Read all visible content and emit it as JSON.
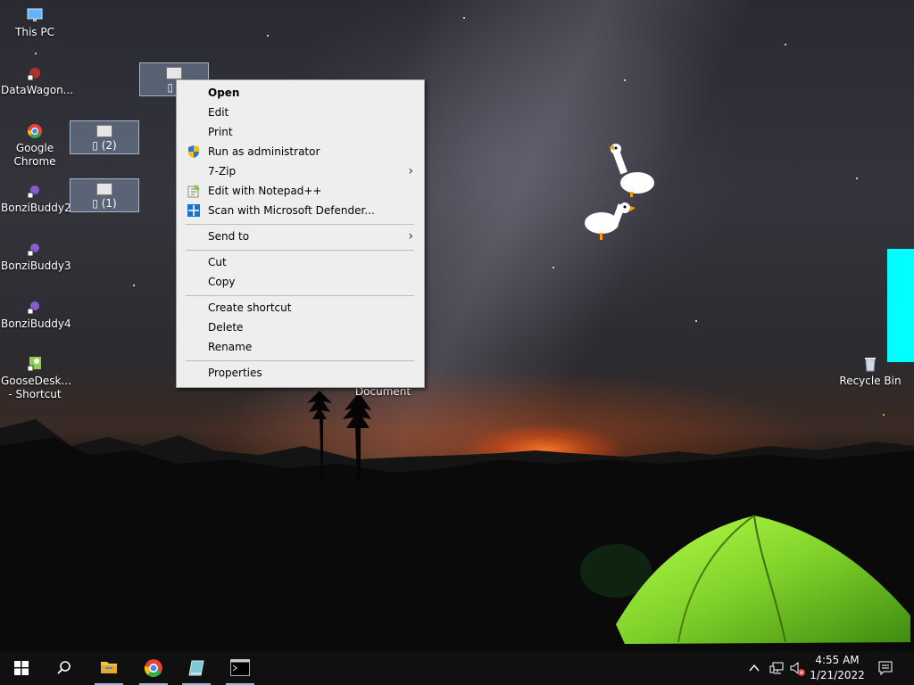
{
  "desktop": {
    "icons": [
      {
        "label": "This PC",
        "icon": "monitor-icon"
      },
      {
        "label": "DataWagon...",
        "icon": "datawagon-icon"
      },
      {
        "label": "Google Chrome",
        "icon": "chrome-icon"
      },
      {
        "label": "BonziBuddy2",
        "icon": "bonzibuddy-icon"
      },
      {
        "label": "BonziBuddy3",
        "icon": "bonzibuddy-icon"
      },
      {
        "label": "BonziBuddy4",
        "icon": "bonzibuddy-icon"
      },
      {
        "label": "GooseDesk... - Shortcut",
        "icon": "goose-shortcut-icon"
      },
      {
        "label": "Recycle Bin",
        "icon": "recycle-bin-icon"
      },
      {
        "label": "Document",
        "icon": "document-icon"
      }
    ],
    "selected_files": [
      {
        "label": "▯ (",
        "icon": "file-icon"
      },
      {
        "label": "▯ (2)",
        "icon": "file-icon"
      },
      {
        "label": "▯ (1)",
        "icon": "file-icon"
      }
    ],
    "overlay_color": "#00ffff"
  },
  "context_menu": {
    "items": [
      {
        "label": "Open",
        "bold": true
      },
      {
        "label": "Edit"
      },
      {
        "label": "Print"
      },
      {
        "label": "Run as administrator",
        "icon": "uac-shield-icon"
      },
      {
        "label": "7-Zip",
        "submenu": true
      },
      {
        "label": "Edit with Notepad++",
        "icon": "notepadpp-icon"
      },
      {
        "label": "Scan with Microsoft Defender...",
        "icon": "defender-icon"
      },
      {
        "label": "Send to",
        "submenu": true
      },
      {
        "label": "Cut"
      },
      {
        "label": "Copy"
      },
      {
        "label": "Create shortcut"
      },
      {
        "label": "Delete"
      },
      {
        "label": "Rename"
      },
      {
        "label": "Properties"
      }
    ],
    "submenu_arrow": "›"
  },
  "taskbar": {
    "apps": [
      {
        "name": "start-button",
        "icon": "windows-logo-icon"
      },
      {
        "name": "search-button",
        "icon": "search-icon"
      },
      {
        "name": "file-explorer",
        "icon": "folder-icon"
      },
      {
        "name": "chrome",
        "icon": "chrome-icon"
      },
      {
        "name": "app-book",
        "icon": "book-icon"
      },
      {
        "name": "command-prompt",
        "icon": "terminal-icon"
      }
    ],
    "clock": {
      "time": "4:55 AM",
      "date": "1/21/2022"
    }
  }
}
